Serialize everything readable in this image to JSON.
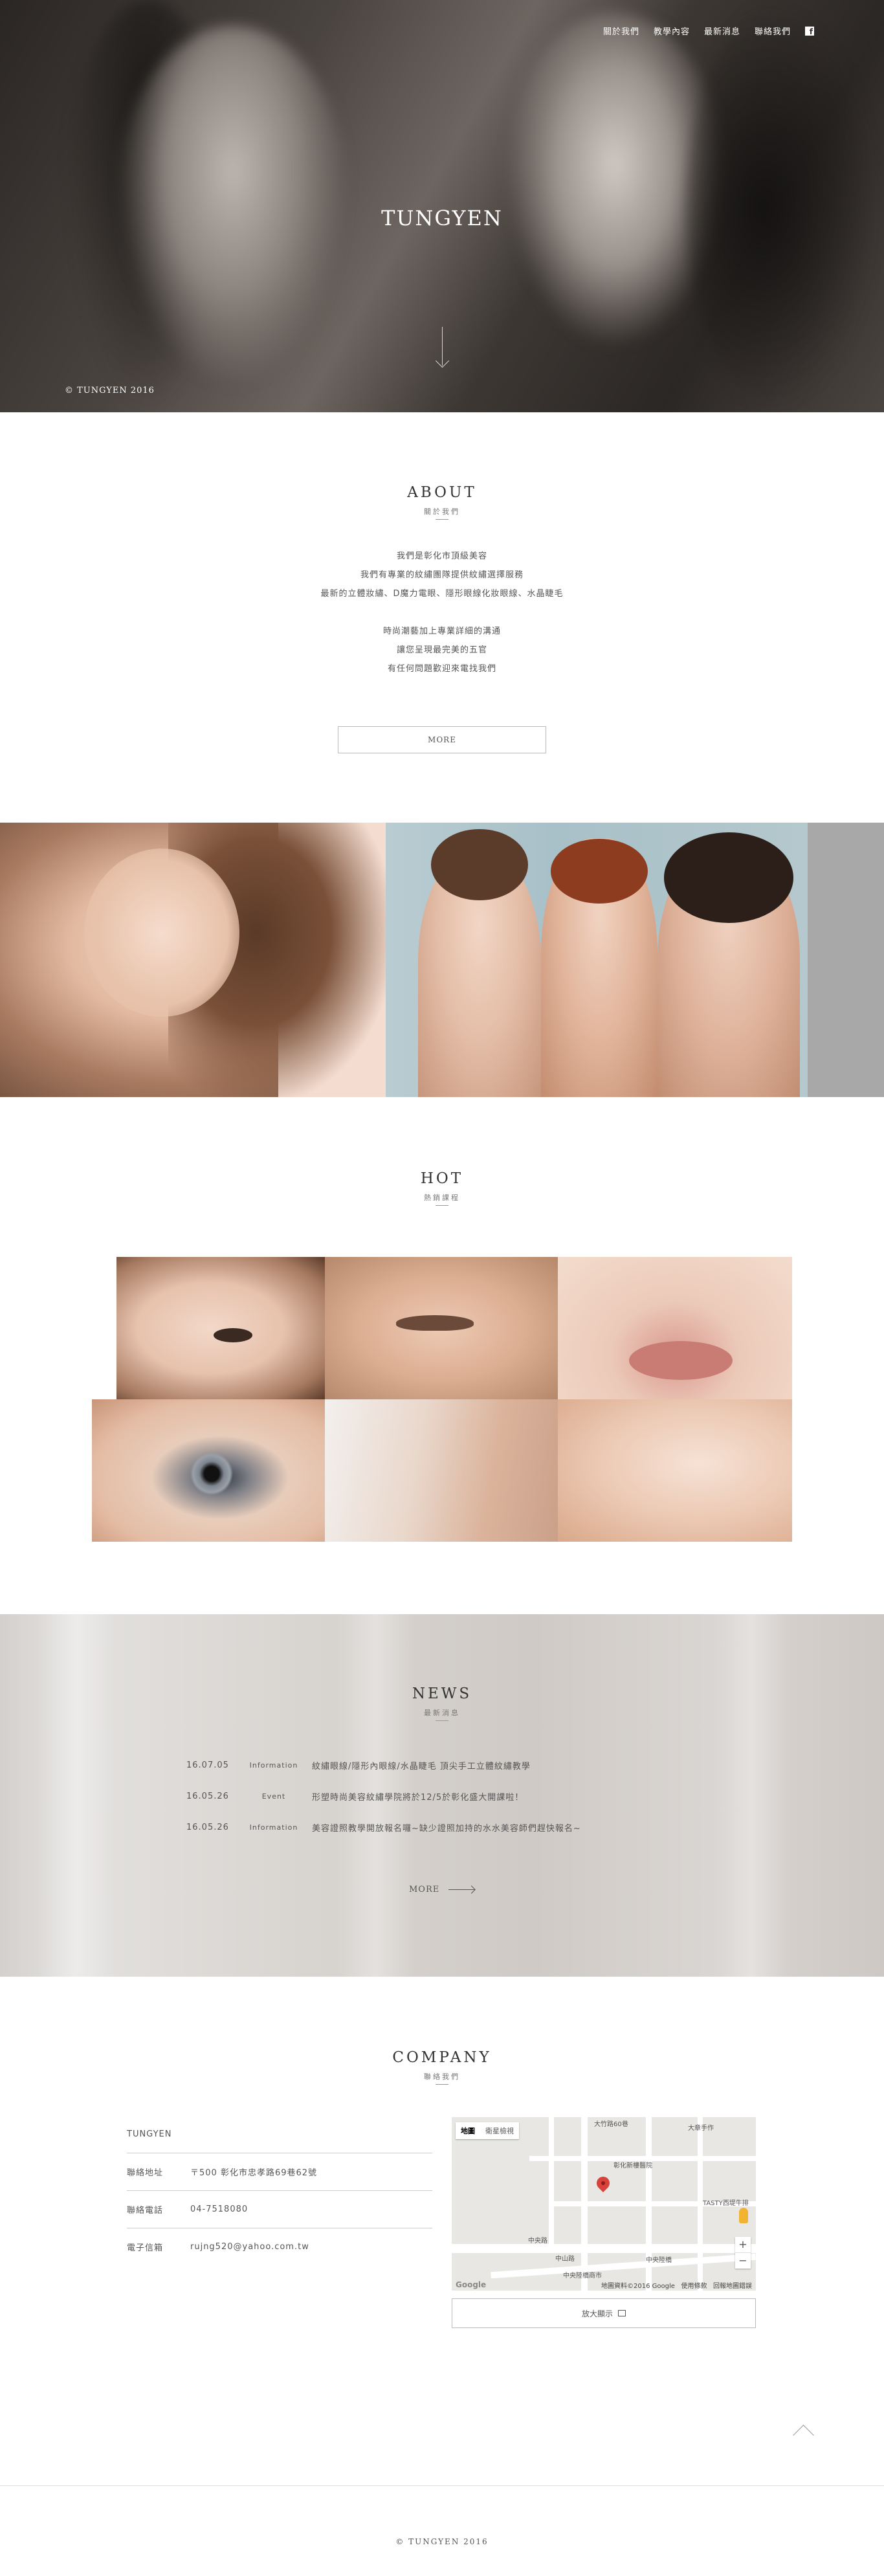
{
  "nav": {
    "items": [
      {
        "label": "關於我們"
      },
      {
        "label": "教學內容"
      },
      {
        "label": "最新消息"
      },
      {
        "label": "聯絡我們"
      }
    ],
    "social_icon": "facebook-icon"
  },
  "hero": {
    "title": "TUNGYEN",
    "copyright": "© TUNGYEN 2016"
  },
  "about": {
    "title": "ABOUT",
    "subtitle": "關於我們",
    "paragraph1": [
      "我們是彰化市頂級美容",
      "我們有專業的紋繡團隊提供紋繡選擇服務",
      "最新的立體妝繡、D魔力電眼、隱形眼線化妝眼線、水晶睫毛"
    ],
    "paragraph2": [
      "時尚潮藝加上專業詳細的溝通",
      "讓您呈現最完美的五官",
      "有任何問題歡迎來電找我們"
    ],
    "more_label": "MORE"
  },
  "hot": {
    "title": "HOT",
    "subtitle": "熱銷課程"
  },
  "news": {
    "title": "NEWS",
    "subtitle": "最新消息",
    "items": [
      {
        "date": "16.07.05",
        "category": "Information",
        "title": "紋繡眼線/隱形內眼線/水晶睫毛 頂尖手工立體紋繡教學"
      },
      {
        "date": "16.05.26",
        "category": "Event",
        "title": "形塑時尚美容紋繡學院將於12/5於彰化盛大開課啦！"
      },
      {
        "date": "16.05.26",
        "category": "Information",
        "title": "美容證照教學開放報名囉~缺少證照加持的水水美容師們趕快報名~"
      }
    ],
    "more_label": "MORE"
  },
  "company": {
    "title": "COMPANY",
    "subtitle": "聯絡我們",
    "name": "TUNGYEN",
    "rows": [
      {
        "label": "聯絡地址",
        "value": "〒500 彰化市忠孝路69巷62號"
      },
      {
        "label": "聯絡電話",
        "value": "04-7518080"
      },
      {
        "label": "電子信箱",
        "value": "rujng520@yahoo.com.tw"
      }
    ]
  },
  "map": {
    "type_map": "地圖",
    "type_satellite": "衛星檢視",
    "labels": {
      "street": "大竹路60巷",
      "hospital": "彰化新樓醫院",
      "shop": "大章手作",
      "tasty": "TASTY西堤牛排",
      "road1": "中央路",
      "road2": "中央陸橋",
      "market": "中央陸橋商市",
      "zhongshan": "中山路"
    },
    "footer_data": "地圖資料©2016 Google",
    "footer_terms": "使用條款",
    "footer_report": "回報地圖錯誤",
    "google": "Google",
    "zoom_in": "+",
    "zoom_out": "−",
    "enlarge_label": "放大顯示"
  },
  "footer": {
    "copyright": "© TUNGYEN 2016"
  }
}
